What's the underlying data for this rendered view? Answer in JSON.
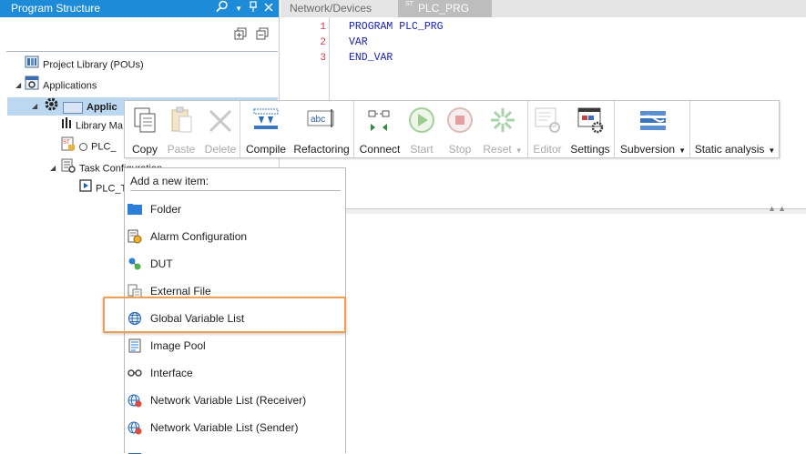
{
  "left_panel": {
    "title": "Program Structure",
    "tree": {
      "project_library": "Project Library (POUs)",
      "applications": "Applications",
      "application_node": "Applic",
      "library_manager": "Library Ma",
      "plc_prg_node": "PLC_",
      "task_configuration": "Task Configuration",
      "plc_task_node": "PLC_T"
    }
  },
  "tabs": [
    {
      "label": "Network/Devices",
      "active": false
    },
    {
      "label": "PLC_PRG",
      "active": true,
      "prefix": "ST"
    }
  ],
  "editor": {
    "lines": [
      {
        "number": "1",
        "code": "PROGRAM PLC_PRG"
      },
      {
        "number": "2",
        "code": "VAR"
      },
      {
        "number": "3",
        "code": "END_VAR"
      }
    ]
  },
  "ribbon": {
    "copy": "Copy",
    "paste": "Paste",
    "delete": "Delete",
    "compile": "Compile",
    "refactoring": "Refactoring",
    "refactoring_icon_text": "abc",
    "connect": "Connect",
    "start": "Start",
    "stop": "Stop",
    "reset": "Reset",
    "editor": "Editor",
    "settings": "Settings",
    "subversion": "Subversion",
    "static_analysis": "Static analysis"
  },
  "context_menu": {
    "header": "Add a new item:",
    "items": [
      {
        "label": "Folder",
        "icon": "folder-icon"
      },
      {
        "label": "Alarm Configuration",
        "icon": "alarm-configuration-icon"
      },
      {
        "label": "DUT",
        "icon": "dut-icon"
      },
      {
        "label": "External File",
        "icon": "external-file-icon"
      },
      {
        "label": "Global Variable List",
        "icon": "global-variable-list-icon",
        "highlighted": true
      },
      {
        "label": "Image Pool",
        "icon": "image-pool-icon"
      },
      {
        "label": "Interface",
        "icon": "interface-icon"
      },
      {
        "label": "Network Variable List (Receiver)",
        "icon": "network-variable-receiver-icon"
      },
      {
        "label": "Network Variable List (Sender)",
        "icon": "network-variable-sender-icon"
      }
    ]
  },
  "colors": {
    "header_blue": "#1e8bd8",
    "selection": "#bcd8f0",
    "highlight_orange": "#f0a050",
    "keyword_blue": "#1b22b5",
    "line_number_red": "#d0394b"
  }
}
